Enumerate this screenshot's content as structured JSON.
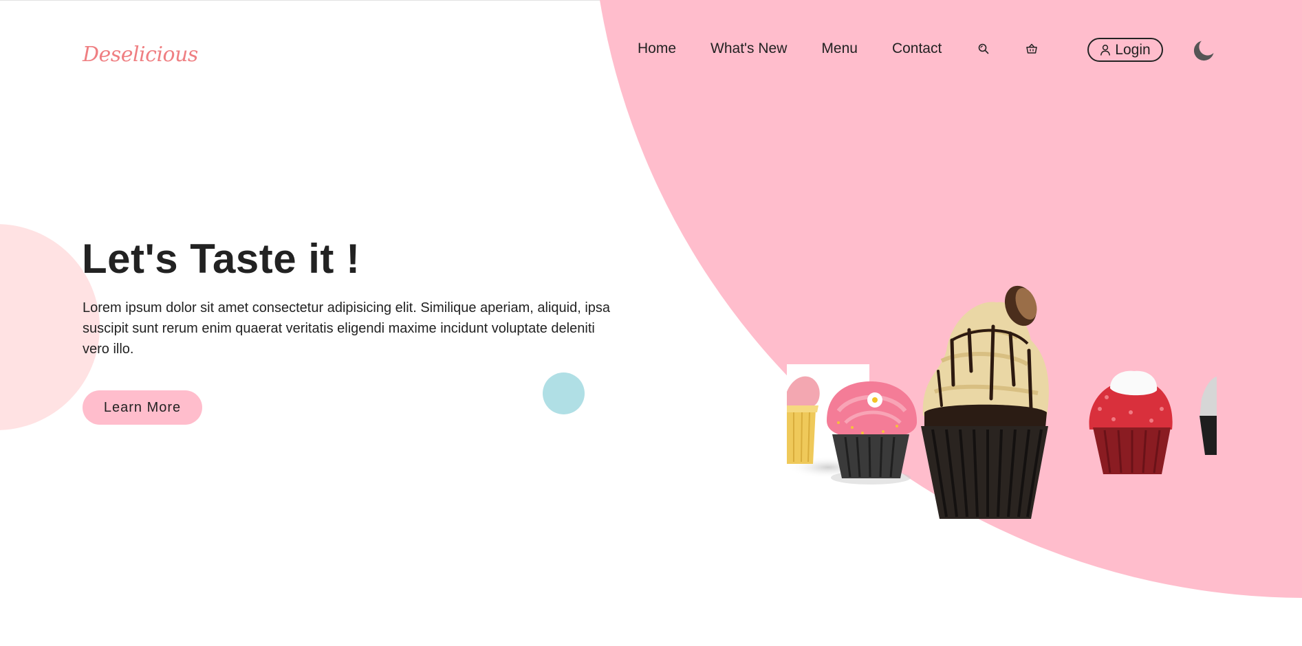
{
  "brand": {
    "logo": "Deselicious"
  },
  "nav": {
    "links": [
      "Home",
      "What's New",
      "Menu",
      "Contact"
    ],
    "login_label": "Login"
  },
  "hero": {
    "title": "Let's Taste it !",
    "description": "Lorem ipsum dolor sit amet consectetur adipisicing elit. Similique aperiam, aliquid, ipsa suscipit sunt rerum enim quaerat veritatis eligendi maxime incidunt voluptate deleniti vero illo.",
    "cta_label": "Learn More"
  },
  "icons": {
    "search": "search-icon",
    "cart": "basket-icon",
    "user": "user-icon",
    "theme": "moon-icon"
  },
  "colors": {
    "accent_pink": "#ffbdcc",
    "logo_coral": "#ef7f82",
    "soft_pink": "#ffe2e3",
    "teal": "#b0dfe5",
    "text": "#222222"
  }
}
